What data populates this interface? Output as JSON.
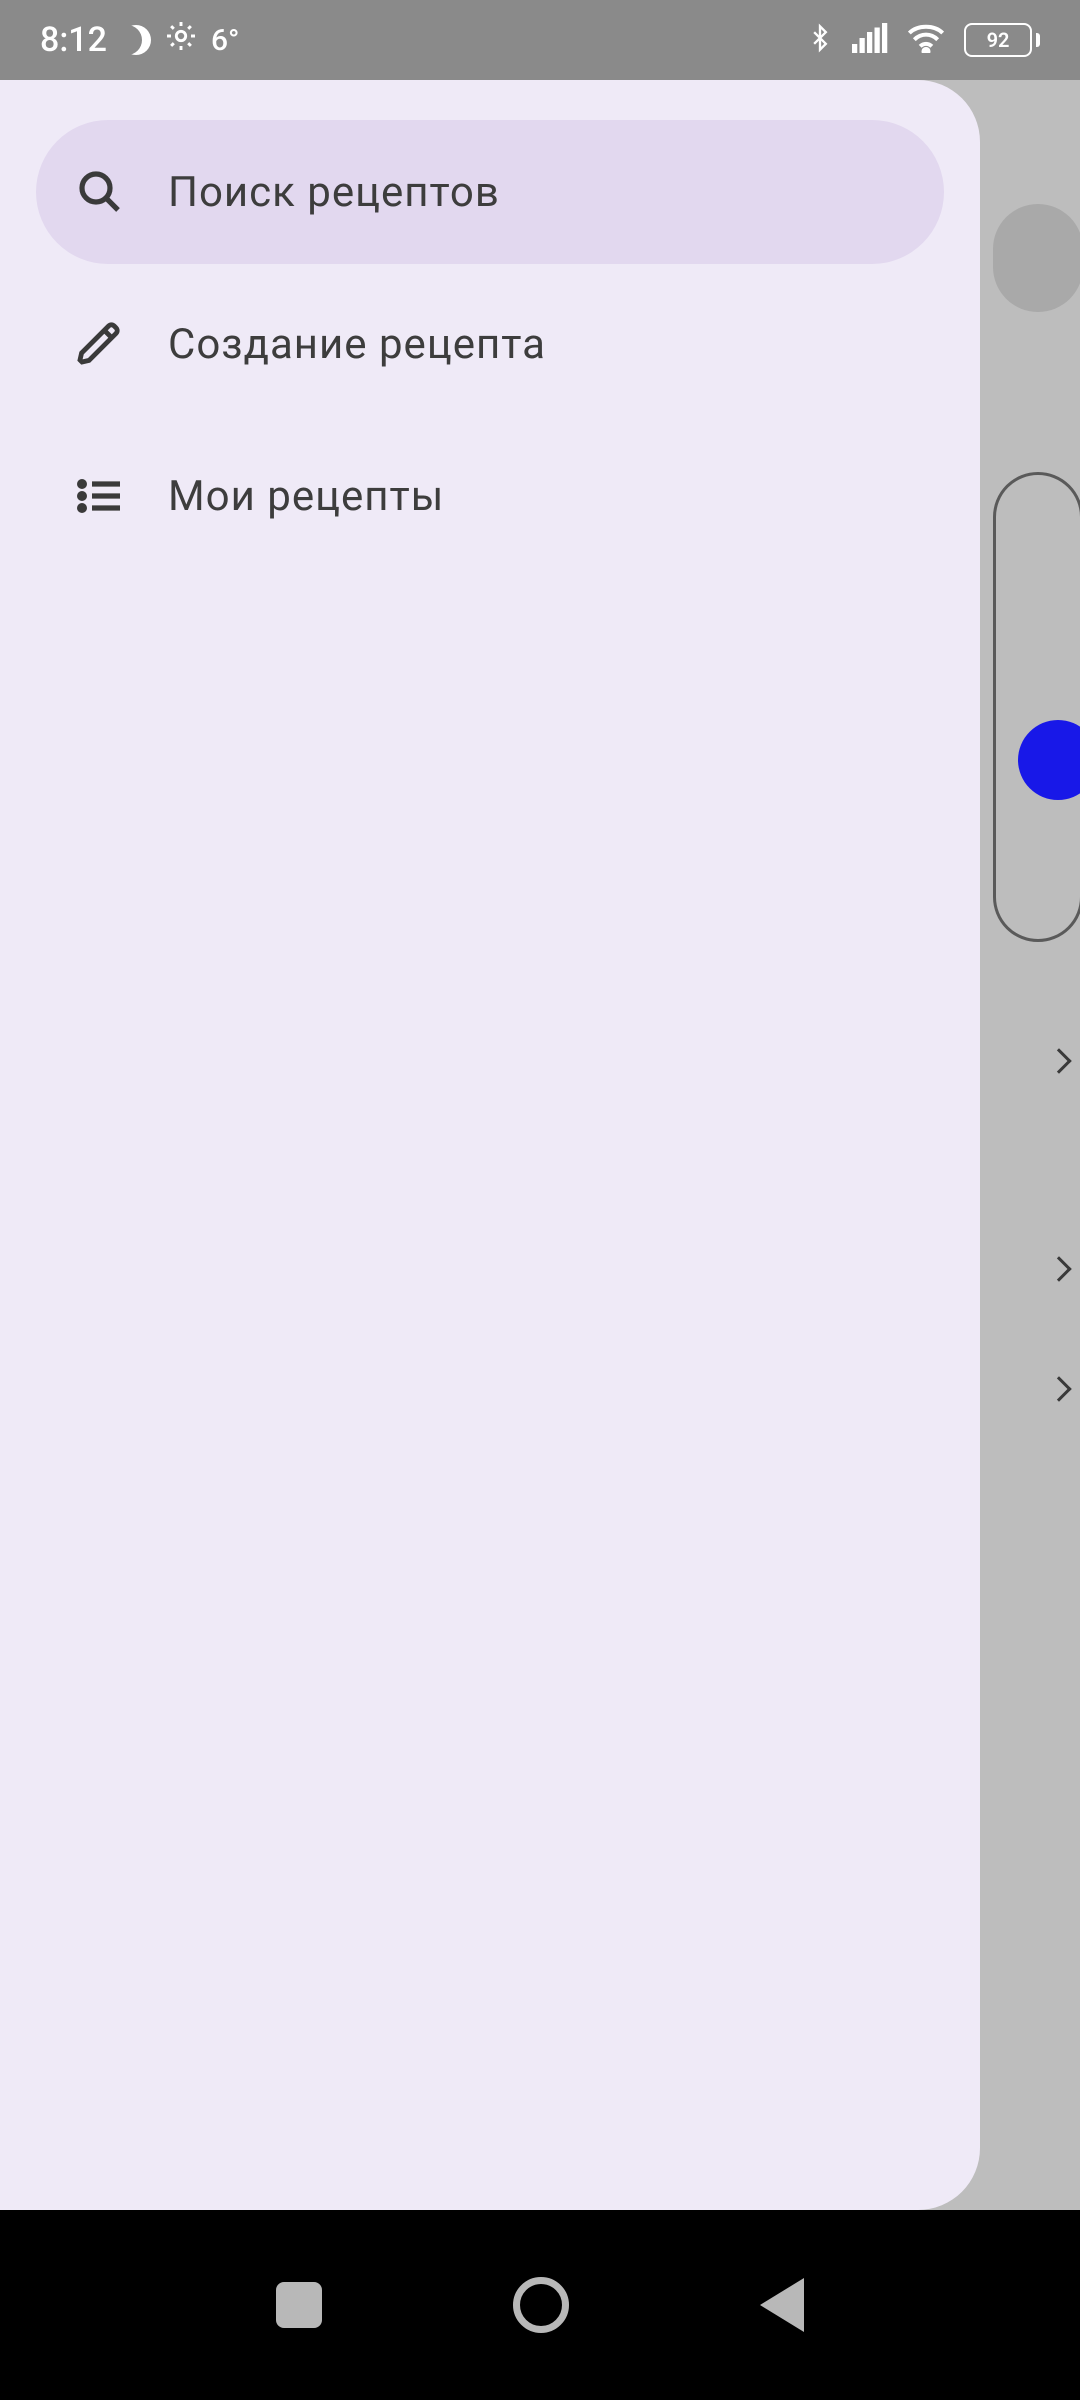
{
  "status": {
    "time": "8:12",
    "temperature": "6°",
    "battery": "92"
  },
  "drawer": {
    "items": [
      {
        "label": "Поиск рецептов",
        "selected": true
      },
      {
        "label": "Создание рецепта",
        "selected": false
      },
      {
        "label": "Мои рецепты",
        "selected": false
      }
    ]
  }
}
